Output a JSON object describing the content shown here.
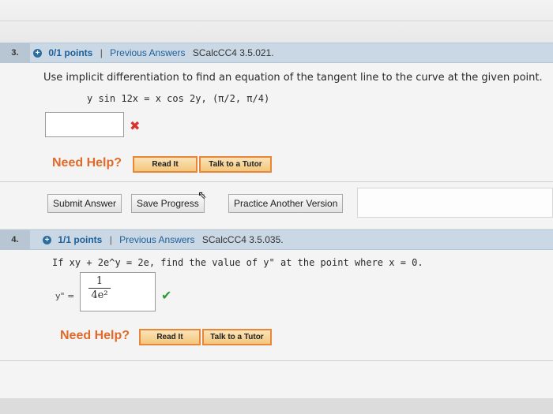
{
  "q3": {
    "number": "3.",
    "plus": "+",
    "points": "0/1 points",
    "separator": "|",
    "previous_answers": "Previous Answers",
    "code": "SCalcCC4 3.5.021.",
    "prompt": "Use implicit differentiation to find an equation of the tangent line to the curve at the given point.",
    "equation": "y sin 12x = x cos 2y,   (π/2, π/4)",
    "answer_value": "",
    "result_icon": "x-icon",
    "need_help": "Need Help?",
    "read_it": "Read It",
    "talk_to_tutor": "Talk to a Tutor",
    "submit_answer": "Submit Answer",
    "save_progress": "Save Progress",
    "practice_another": "Practice Another Version"
  },
  "q4": {
    "number": "4.",
    "plus": "+",
    "points": "1/1 points",
    "separator": "|",
    "previous_answers": "Previous Answers",
    "code": "SCalcCC4 3.5.035.",
    "prompt": "If xy + 2e^y = 2e, find the value of y\" at the point where x = 0.",
    "answer_label": "y\" =",
    "answer_numerator": "1",
    "answer_denominator": "4e²",
    "result_icon": "check-icon",
    "need_help": "Need Help?",
    "read_it": "Read It",
    "talk_to_tutor": "Talk to a Tutor"
  },
  "colors": {
    "header_bg": "#c9d8e4",
    "link_blue": "#1e5f9a",
    "help_orange": "#e06a2a",
    "incorrect_red": "#d9342b",
    "correct_green": "#2e9a3a"
  }
}
